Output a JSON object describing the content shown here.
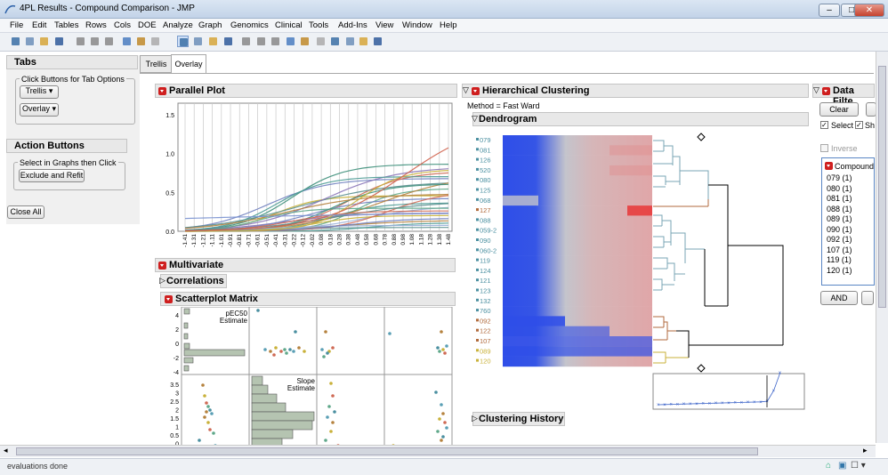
{
  "window": {
    "title": "4PL Results - Compound Comparison - JMP",
    "minimize": "–",
    "maximize": "□",
    "close": "✕"
  },
  "menu": [
    "File",
    "Edit",
    "Tables",
    "Rows",
    "Cols",
    "DOE",
    "Analyze",
    "Graph",
    "Genomics",
    "Clinical",
    "Tools",
    "Add-Ins",
    "View",
    "Window",
    "Help"
  ],
  "left": {
    "tabs_title": "Tabs",
    "tabs_group": "Click Buttons for Tab Options",
    "trellis_btn": "Trellis",
    "overlay_btn": "Overlay",
    "action_title": "Action Buttons",
    "action_group": "Select in Graphs then Click",
    "exclude_btn": "Exclude and Refit",
    "close_all": "Close All"
  },
  "tabs": {
    "trellis": "Trellis",
    "overlay": "Overlay"
  },
  "parallel": {
    "title": "Parallel Plot",
    "yticks": [
      "1.5",
      "1.0",
      "0.5",
      "0.0"
    ],
    "xticks": [
      "-1.41",
      "-1.31",
      "-1.21",
      "-1.11",
      "-1.01",
      "-0.91",
      "-0.81",
      "-0.71",
      "-0.61",
      "-0.51",
      "-0.41",
      "-0.31",
      "-0.22",
      "-0.12",
      "-0.02",
      "0.08",
      "0.18",
      "0.28",
      "0.38",
      "0.48",
      "0.58",
      "0.68",
      "0.78",
      "0.88",
      "0.98",
      "1.08",
      "1.18",
      "1.28",
      "1.38",
      "1.48"
    ]
  },
  "multivariate": {
    "title": "Multivariate",
    "correlations": "Correlations",
    "scatter": "Scatterplot Matrix",
    "pec50": "pEC50",
    "estimate": "Estimate",
    "slope": "Slope",
    "estimate2": "Estimate",
    "yticks1": [
      "4",
      "2",
      "0",
      "-2",
      "-4"
    ],
    "yticks2": [
      "3.5",
      "3",
      "2.5",
      "2",
      "1.5",
      "1",
      "0.5",
      "0"
    ]
  },
  "cluster": {
    "title": "Hierarchical Clustering",
    "method": "Method = Fast Ward",
    "dendro": "Dendrogram",
    "history": "Clustering History",
    "labels": [
      "079",
      "081",
      "126",
      "520",
      "080",
      "125",
      "068",
      "127",
      "088",
      "059-2",
      "090",
      "060-2",
      "119",
      "124",
      "121",
      "123",
      "132",
      "760",
      "092",
      "122",
      "107",
      "089",
      "120"
    ],
    "label_colors": [
      "#4a8fa0",
      "#4a8fa0",
      "#4a8fa0",
      "#4a8fa0",
      "#4a8fa0",
      "#4a8fa0",
      "#4a8fa0",
      "#b06a3c",
      "#4a8fa0",
      "#4a8fa0",
      "#4a8fa0",
      "#4a8fa0",
      "#4a8fa0",
      "#4a8fa0",
      "#4a8fa0",
      "#4a8fa0",
      "#4a8fa0",
      "#4a8fa0",
      "#b06a3c",
      "#b06a3c",
      "#b06a3c",
      "#c9b13a",
      "#c9b13a"
    ]
  },
  "filter": {
    "title": "Data Filte",
    "clear": "Clear",
    "select": "Select",
    "show": "Sh",
    "inverse": "Inverse",
    "compound": "Compound",
    "items": [
      "079 (1)",
      "080 (1)",
      "081 (1)",
      "088 (1)",
      "089 (1)",
      "090 (1)",
      "092 (1)",
      "107 (1)",
      "119 (1)",
      "120 (1)"
    ],
    "and": "AND"
  },
  "status": {
    "text": "evaluations done"
  },
  "colors": {
    "accent": "#cf1f1f",
    "heat_low": "#2f4ee8",
    "heat_high": "#e83030"
  }
}
